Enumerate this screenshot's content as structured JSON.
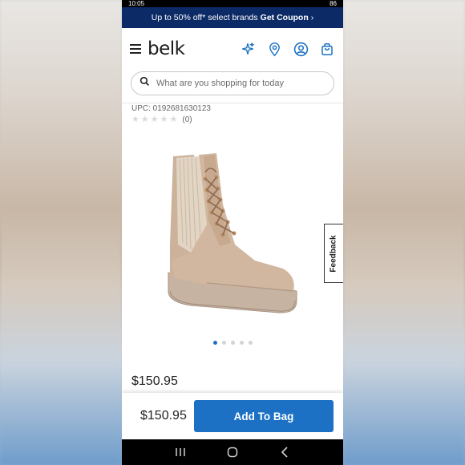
{
  "status_bar": {
    "time": "10:05",
    "battery": "86"
  },
  "promo": {
    "text": "Up to 50% off* select brands",
    "cta": "Get Coupon",
    "chevron": "›"
  },
  "header": {
    "logo": "belk",
    "icons": [
      "sparkle-icon",
      "location-pin-icon",
      "account-icon",
      "shopping-bag-icon"
    ]
  },
  "search": {
    "placeholder": "What are you shopping for today"
  },
  "product": {
    "upc": "UPC: 0192681630123",
    "rating_stars": 0,
    "rating_count": "(0)",
    "price": "$150.95",
    "image_count": 5,
    "active_image_index": 0
  },
  "feedback": {
    "label": "Feedback"
  },
  "bottom_bar": {
    "price": "$150.95",
    "add_to_bag": "Add To Bag"
  },
  "android_nav": {
    "recents": "|||",
    "home": "○",
    "back": "‹"
  },
  "colors": {
    "promo_bg": "#0b2a66",
    "accent": "#1c71c4",
    "active_dot": "#1f6fbf"
  }
}
